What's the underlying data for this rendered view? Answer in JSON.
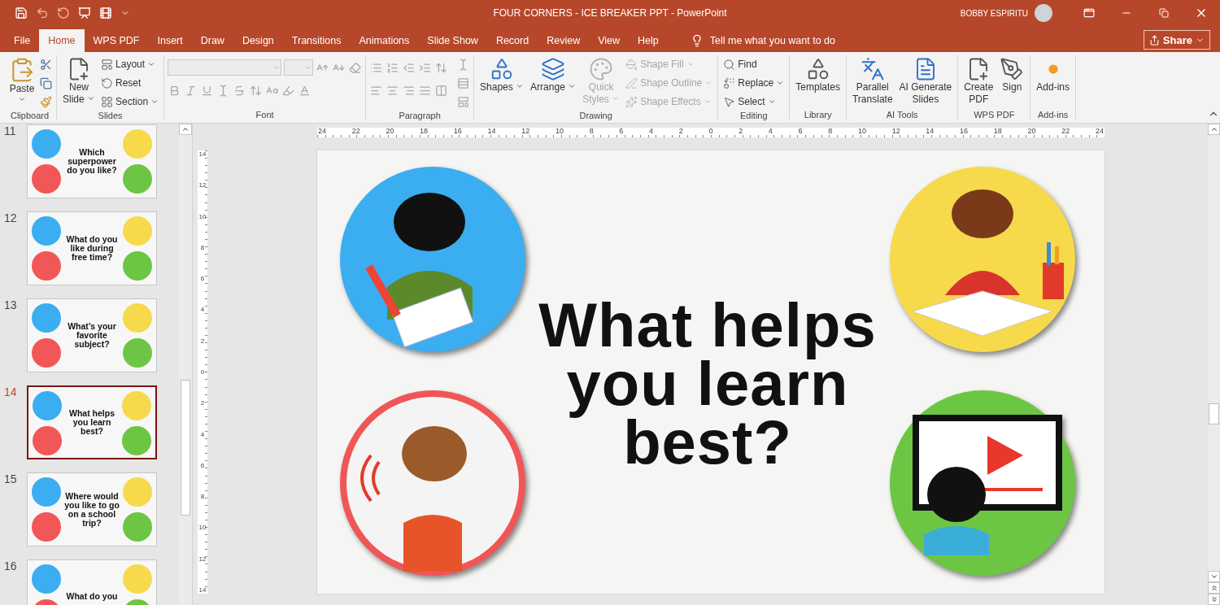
{
  "window": {
    "title": "FOUR CORNERS - ICE BREAKER PPT - PowerPoint",
    "user": "BOBBY ESPIRITU"
  },
  "tabs": [
    {
      "label": "File",
      "selected": false
    },
    {
      "label": "Home",
      "selected": true
    },
    {
      "label": "WPS PDF",
      "selected": false
    },
    {
      "label": "Insert",
      "selected": false
    },
    {
      "label": "Draw",
      "selected": false
    },
    {
      "label": "Design",
      "selected": false
    },
    {
      "label": "Transitions",
      "selected": false
    },
    {
      "label": "Animations",
      "selected": false
    },
    {
      "label": "Slide Show",
      "selected": false
    },
    {
      "label": "Record",
      "selected": false
    },
    {
      "label": "Review",
      "selected": false
    },
    {
      "label": "View",
      "selected": false
    },
    {
      "label": "Help",
      "selected": false
    }
  ],
  "tell_me": "Tell me what you want to do",
  "share": "Share",
  "ribbon": [
    {
      "label": "Clipboard",
      "kind": "clipboard",
      "items": [
        {
          "label": "Paste",
          "kind": "large",
          "dropdown": true,
          "disabled": false
        }
      ]
    },
    {
      "label": "Slides",
      "kind": "standard",
      "items": [
        {
          "label": "New\nSlide",
          "kind": "large",
          "dropdown": true,
          "disabled": false
        },
        {
          "label": "Layout",
          "kind": "small",
          "dropdown": true,
          "disabled": false
        },
        {
          "label": "Reset",
          "kind": "small",
          "dropdown": false,
          "disabled": false
        },
        {
          "label": "Section",
          "kind": "small",
          "dropdown": true,
          "disabled": false
        }
      ]
    },
    {
      "label": "Font",
      "kind": "font",
      "disabled": true
    },
    {
      "label": "Paragraph",
      "kind": "paragraph",
      "disabled": true
    },
    {
      "label": "Drawing",
      "kind": "standard",
      "items": [
        {
          "label": "Shapes",
          "kind": "large",
          "dropdown": true,
          "disabled": false
        },
        {
          "label": "Arrange",
          "kind": "large",
          "dropdown": true,
          "disabled": false
        },
        {
          "label": "Quick\nStyles",
          "kind": "large",
          "dropdown": true,
          "disabled": true
        },
        {
          "label": "Shape Fill",
          "kind": "small",
          "dropdown": true,
          "disabled": true
        },
        {
          "label": "Shape Outline",
          "kind": "small",
          "dropdown": true,
          "disabled": true
        },
        {
          "label": "Shape Effects",
          "kind": "small",
          "dropdown": true,
          "disabled": true
        }
      ]
    },
    {
      "label": "Editing",
      "kind": "standard",
      "items": [
        {
          "label": "Find",
          "kind": "small",
          "dropdown": false,
          "disabled": false
        },
        {
          "label": "Replace",
          "kind": "small",
          "dropdown": true,
          "disabled": false
        },
        {
          "label": "Select",
          "kind": "small",
          "dropdown": true,
          "disabled": false
        }
      ]
    },
    {
      "label": "Library",
      "kind": "standard",
      "items": [
        {
          "label": "Templates",
          "kind": "large",
          "dropdown": false,
          "disabled": false
        }
      ]
    },
    {
      "label": "AI Tools",
      "kind": "standard",
      "items": [
        {
          "label": "Parallel\nTranslate",
          "kind": "large",
          "dropdown": false,
          "disabled": false
        },
        {
          "label": "AI Generate\nSlides",
          "kind": "large",
          "dropdown": false,
          "disabled": false
        }
      ]
    },
    {
      "label": "WPS PDF",
      "kind": "standard",
      "items": [
        {
          "label": "Create\nPDF",
          "kind": "large",
          "dropdown": false,
          "disabled": false
        },
        {
          "label": "Sign",
          "kind": "large",
          "dropdown": false,
          "disabled": false
        }
      ]
    },
    {
      "label": "Add-ins",
      "kind": "standard",
      "items": [
        {
          "label": "Add-ins",
          "kind": "large",
          "dropdown": false,
          "disabled": false
        }
      ]
    }
  ],
  "slides": [
    {
      "number": "11",
      "title": "Which\nsuperpower\ndo you like?",
      "selected": false
    },
    {
      "number": "12",
      "title": "What do you\nlike during\nfree time?",
      "selected": false
    },
    {
      "number": "13",
      "title": "What’s your\nfavorite\nsubject?",
      "selected": false
    },
    {
      "number": "14",
      "title": "What helps\nyou learn\nbest?",
      "selected": true
    },
    {
      "number": "15",
      "title": "Where would\nyou like to go\non a school\ntrip?",
      "selected": false
    },
    {
      "number": "16",
      "title": "What do you",
      "selected": false
    }
  ],
  "ruler": {
    "horizontal": [
      "24",
      "22",
      "20",
      "18",
      "16",
      "14",
      "12",
      "10",
      "8",
      "6",
      "4",
      "2",
      "0",
      "2",
      "4",
      "6",
      "8",
      "10",
      "12",
      "14",
      "16",
      "18",
      "20",
      "22",
      "24"
    ],
    "vertical": [
      "14",
      "12",
      "10",
      "8",
      "6",
      "4",
      "2",
      "0",
      "2",
      "4",
      "6",
      "8",
      "10",
      "12",
      "14"
    ]
  },
  "slide": {
    "title": "What helps\nyou learn\nbest?"
  }
}
